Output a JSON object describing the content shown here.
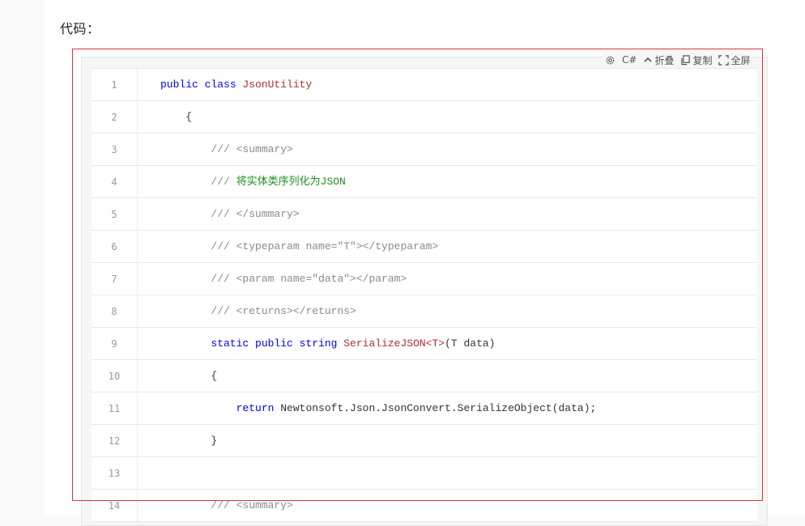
{
  "intro": {
    "text": "代码："
  },
  "toolbar": {
    "language": "C#",
    "fold_label": "折叠",
    "copy_label": "复制",
    "fullscreen_label": "全屏"
  },
  "code_lines": [
    {
      "no": "1",
      "indent": "",
      "parts": [
        {
          "t": "public class ",
          "c": "kw"
        },
        {
          "t": "JsonUtility",
          "c": "cls"
        }
      ]
    },
    {
      "no": "2",
      "indent": "    ",
      "parts": [
        {
          "t": "{",
          "c": ""
        }
      ]
    },
    {
      "no": "3",
      "indent": "        ",
      "parts": [
        {
          "t": "/// <summary>",
          "c": "cm"
        }
      ]
    },
    {
      "no": "4",
      "indent": "        ",
      "parts": [
        {
          "t": "/// ",
          "c": "cm"
        },
        {
          "t": "将实体类序列化为JSON",
          "c": "cmg"
        }
      ]
    },
    {
      "no": "5",
      "indent": "        ",
      "parts": [
        {
          "t": "/// </summary>",
          "c": "cm"
        }
      ]
    },
    {
      "no": "6",
      "indent": "        ",
      "parts": [
        {
          "t": "/// <typeparam name=\"T\"></typeparam>",
          "c": "cm"
        }
      ]
    },
    {
      "no": "7",
      "indent": "        ",
      "parts": [
        {
          "t": "/// <param name=\"data\"></param>",
          "c": "cm"
        }
      ]
    },
    {
      "no": "8",
      "indent": "        ",
      "parts": [
        {
          "t": "/// <returns></returns>",
          "c": "cm"
        }
      ]
    },
    {
      "no": "9",
      "indent": "        ",
      "parts": [
        {
          "t": "static public string ",
          "c": "kw"
        },
        {
          "t": "SerializeJSON<T>",
          "c": "cls"
        },
        {
          "t": "(T data)",
          "c": ""
        }
      ]
    },
    {
      "no": "10",
      "indent": "        ",
      "parts": [
        {
          "t": "{",
          "c": ""
        }
      ]
    },
    {
      "no": "11",
      "indent": "            ",
      "parts": [
        {
          "t": "return ",
          "c": "kw"
        },
        {
          "t": "Newtonsoft.Json.JsonConvert.SerializeObject(data);",
          "c": ""
        }
      ]
    },
    {
      "no": "12",
      "indent": "        ",
      "parts": [
        {
          "t": "}",
          "c": ""
        }
      ]
    },
    {
      "no": "13",
      "indent": "",
      "parts": []
    },
    {
      "no": "14",
      "indent": "        ",
      "parts": [
        {
          "t": "/// <summary>",
          "c": "cm"
        }
      ]
    }
  ]
}
